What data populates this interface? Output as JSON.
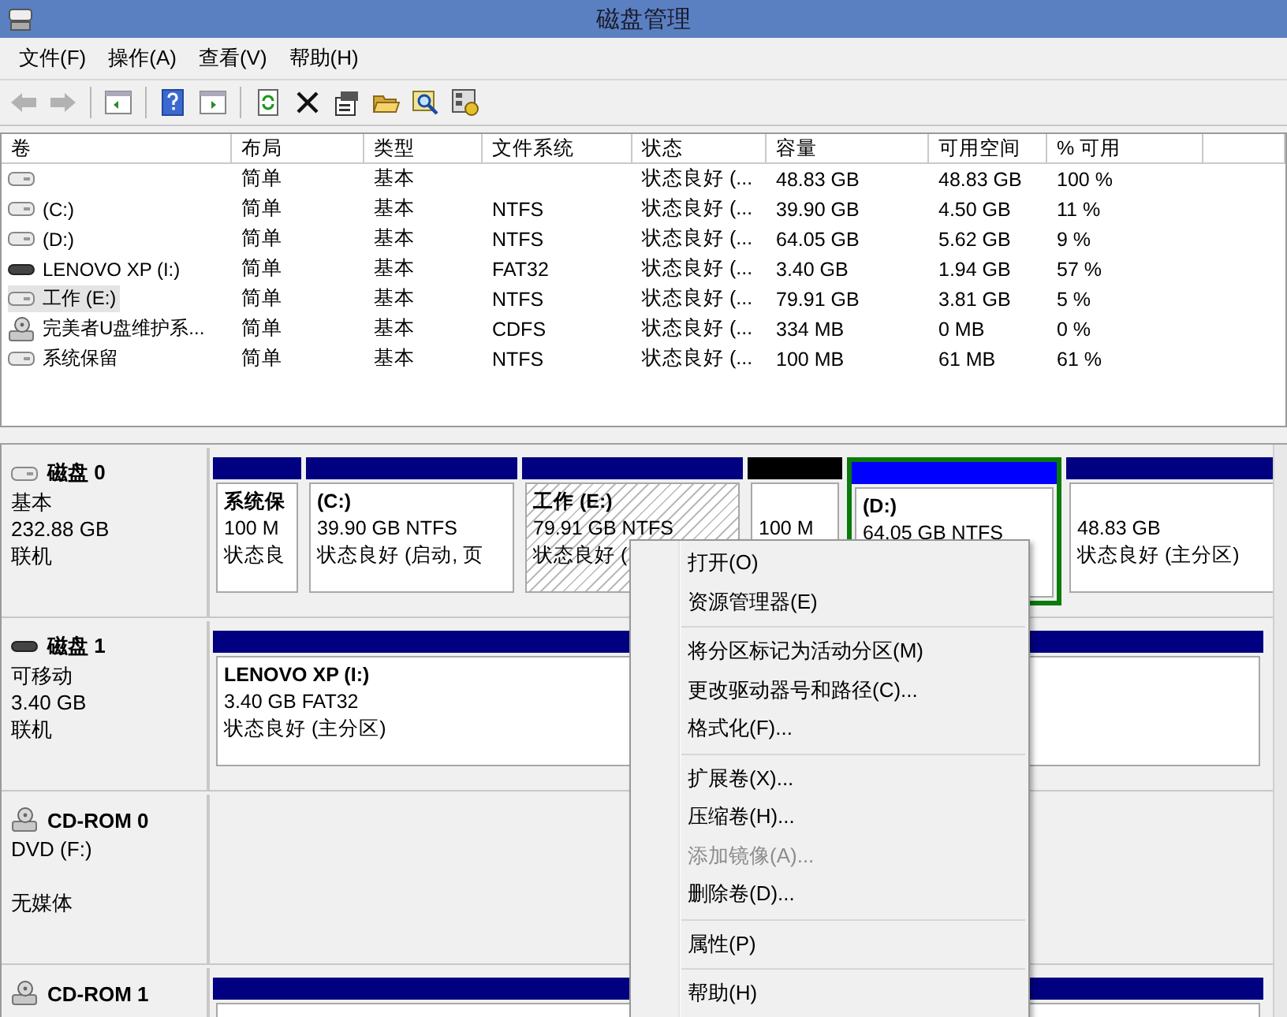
{
  "window": {
    "title": "磁盘管理"
  },
  "menu": [
    "文件(F)",
    "操作(A)",
    "查看(V)",
    "帮助(H)"
  ],
  "toolbar": [
    {
      "kind": "back",
      "disabled": true
    },
    {
      "kind": "forward",
      "disabled": true
    },
    {
      "kind": "sep"
    },
    {
      "kind": "panel-left",
      "disabled": false
    },
    {
      "kind": "sep"
    },
    {
      "kind": "help",
      "disabled": false
    },
    {
      "kind": "panel-right",
      "disabled": false
    },
    {
      "kind": "sep"
    },
    {
      "kind": "refresh",
      "disabled": false
    },
    {
      "kind": "delete",
      "disabled": false
    },
    {
      "kind": "properties",
      "disabled": false
    },
    {
      "kind": "open",
      "disabled": false
    },
    {
      "kind": "search",
      "disabled": false
    },
    {
      "kind": "settings",
      "disabled": false
    }
  ],
  "table": {
    "columns": [
      "卷",
      "布局",
      "类型",
      "文件系统",
      "状态",
      "容量",
      "可用空间",
      "% 可用"
    ],
    "rows": [
      {
        "kind": "disk",
        "selected": false,
        "cells": [
          "",
          "简单",
          "基本",
          "",
          "状态良好 (...",
          "48.83 GB",
          "48.83 GB",
          "100 %"
        ]
      },
      {
        "kind": "disk",
        "selected": false,
        "cells": [
          "(C:)",
          "简单",
          "基本",
          "NTFS",
          "状态良好 (...",
          "39.90 GB",
          "4.50 GB",
          "11 %"
        ]
      },
      {
        "kind": "disk",
        "selected": false,
        "cells": [
          "(D:)",
          "简单",
          "基本",
          "NTFS",
          "状态良好 (...",
          "64.05 GB",
          "5.62 GB",
          "9 %"
        ]
      },
      {
        "kind": "removable",
        "selected": false,
        "cells": [
          "LENOVO XP (I:)",
          "简单",
          "基本",
          "FAT32",
          "状态良好 (...",
          "3.40 GB",
          "1.94 GB",
          "57 %"
        ]
      },
      {
        "kind": "disk",
        "selected": true,
        "cells": [
          "工作 (E:)",
          "简单",
          "基本",
          "NTFS",
          "状态良好 (...",
          "79.91 GB",
          "3.81 GB",
          "5 %"
        ]
      },
      {
        "kind": "cdrom",
        "selected": false,
        "cells": [
          "完美者U盘维护系...",
          "简单",
          "基本",
          "CDFS",
          "状态良好 (...",
          "334 MB",
          "0 MB",
          "0 %"
        ]
      },
      {
        "kind": "disk",
        "selected": false,
        "cells": [
          "系统保留",
          "简单",
          "基本",
          "NTFS",
          "状态良好 (...",
          "100 MB",
          "61 MB",
          "61 %"
        ]
      }
    ]
  },
  "disks": [
    {
      "kind": "disk",
      "name": "磁盘 0",
      "type": "基本",
      "size": "232.88 GB",
      "status": "联机",
      "partitions": [
        {
          "color": "#000080",
          "selected": false,
          "extended": false,
          "name": "系统保",
          "info": [
            "100 M",
            "状态良"
          ]
        },
        {
          "color": "#000080",
          "selected": false,
          "extended": false,
          "name": "(C:)",
          "info": [
            "39.90 GB NTFS",
            "状态良好 (启动, 页"
          ]
        },
        {
          "color": "#000080",
          "selected": true,
          "extended": false,
          "name": "工作  (E:)",
          "info": [
            "79.91 GB NTFS",
            "状态良好 ("
          ]
        },
        {
          "color": "#000000",
          "selected": false,
          "extended": false,
          "info": [
            "100 M"
          ]
        },
        {
          "color": "#0000ff",
          "selected": false,
          "extended": true,
          "name": "(D:)",
          "info": [
            "64.05 GB NTFS"
          ]
        },
        {
          "color": "#000080",
          "selected": false,
          "extended": false,
          "info": [
            "48.83 GB",
            "状态良好 (主分区)"
          ]
        }
      ]
    },
    {
      "kind": "removable",
      "name": "磁盘 1",
      "type": "可移动",
      "size": "3.40 GB",
      "status": "联机",
      "partitions": [
        {
          "color": "#000080",
          "selected": false,
          "extended": false,
          "name": "LENOVO XP  (I:)",
          "info": [
            "3.40 GB FAT32",
            "状态良好 (主分区)"
          ]
        }
      ]
    },
    {
      "kind": "cdrom",
      "name": "CD-ROM 0",
      "type": "DVD (F:)",
      "status": "无媒体"
    },
    {
      "kind": "cdrom",
      "name": "CD-ROM 1",
      "partitions": [
        {
          "color": "#000080",
          "selected": false,
          "extended": false
        }
      ]
    }
  ],
  "context_menu": [
    {
      "kind": "item",
      "label": "打开(O)",
      "disabled": false
    },
    {
      "kind": "item",
      "label": "资源管理器(E)",
      "disabled": false
    },
    {
      "kind": "separator"
    },
    {
      "kind": "item",
      "label": "将分区标记为活动分区(M)",
      "disabled": false
    },
    {
      "kind": "item",
      "label": "更改驱动器号和路径(C)...",
      "disabled": false
    },
    {
      "kind": "item",
      "label": "格式化(F)...",
      "disabled": false
    },
    {
      "kind": "separator"
    },
    {
      "kind": "item",
      "label": "扩展卷(X)...",
      "disabled": false
    },
    {
      "kind": "item",
      "label": "压缩卷(H)...",
      "disabled": false
    },
    {
      "kind": "item",
      "label": "添加镜像(A)...",
      "disabled": true
    },
    {
      "kind": "item",
      "label": "删除卷(D)...",
      "disabled": false
    },
    {
      "kind": "separator"
    },
    {
      "kind": "item",
      "label": "属性(P)",
      "disabled": false
    },
    {
      "kind": "separator"
    },
    {
      "kind": "item",
      "label": "帮助(H)",
      "disabled": false
    }
  ]
}
